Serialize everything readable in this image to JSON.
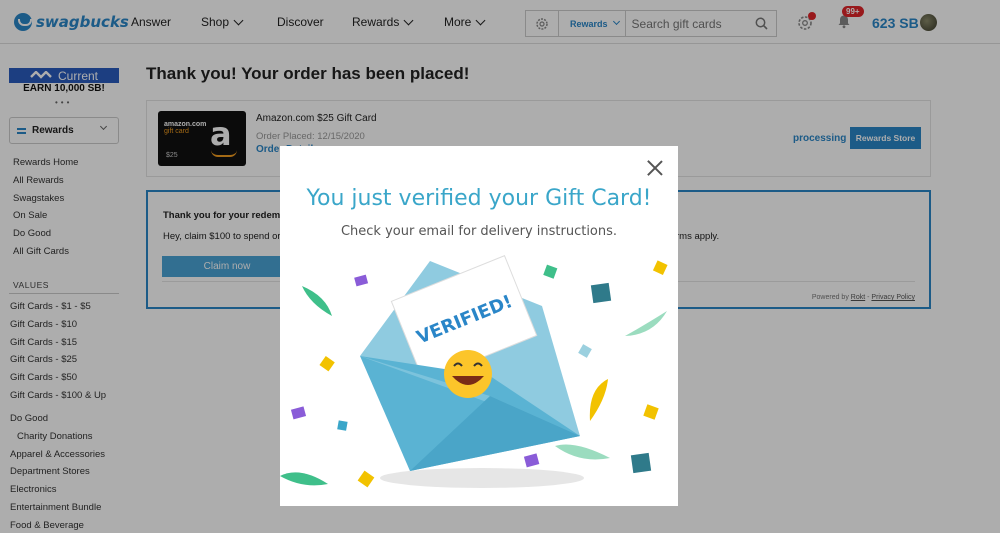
{
  "brand": {
    "name": "swagbucks"
  },
  "nav": {
    "answer": "Answer",
    "shop": "Shop",
    "discover": "Discover",
    "rewards": "Rewards",
    "more": "More"
  },
  "search": {
    "scope": "Rewards",
    "placeholder": "Search gift cards"
  },
  "header": {
    "notifications_badge": "99+",
    "balance": "623 SB"
  },
  "sidebar": {
    "banner": "Current",
    "earn": "EARN 10,000 SB!",
    "dropdown": "Rewards",
    "links": [
      "Rewards Home",
      "All Rewards",
      "Swagstakes",
      "On Sale",
      "Do Good",
      "All Gift Cards"
    ],
    "values_heading": "VALUES",
    "values": [
      "Gift Cards - $1 - $5",
      "Gift Cards - $10",
      "Gift Cards - $15",
      "Gift Cards - $25",
      "Gift Cards - $50",
      "Gift Cards - $100 & Up"
    ],
    "categories": [
      "Do Good",
      "Charity Donations",
      "Apparel & Accessories",
      "Department Stores",
      "Electronics",
      "Entertainment Bundle",
      "Food & Beverage"
    ]
  },
  "main": {
    "title": "Thank you! Your order has been placed!",
    "order": {
      "card_brand": "amazon.com",
      "card_sub": "gift card",
      "card_amount": "$25",
      "name": "Amazon.com $25 Gift Card",
      "placed": "Order Placed: 12/15/2020",
      "link": "Order Details",
      "status": "processing",
      "store_button": "Rewards Store"
    },
    "promo": {
      "title": "Thank you for your redem",
      "text": "Hey, claim $100 to spend or",
      "terms": "rms apply.",
      "button": "Claim now",
      "powered": "Powered by",
      "rokt": "Rokt",
      "sep": " - ",
      "privacy": "Privacy Policy"
    }
  },
  "modal": {
    "title": "You just verified your Gift Card!",
    "subtitle": "Check your email for delivery instructions.",
    "letter_text": "VERIFIED!"
  },
  "colors": {
    "brand_blue": "#2a86c8",
    "modal_title": "#3aa6c9",
    "envelope": "#5ab3d3",
    "badge_red": "#e0262a"
  }
}
